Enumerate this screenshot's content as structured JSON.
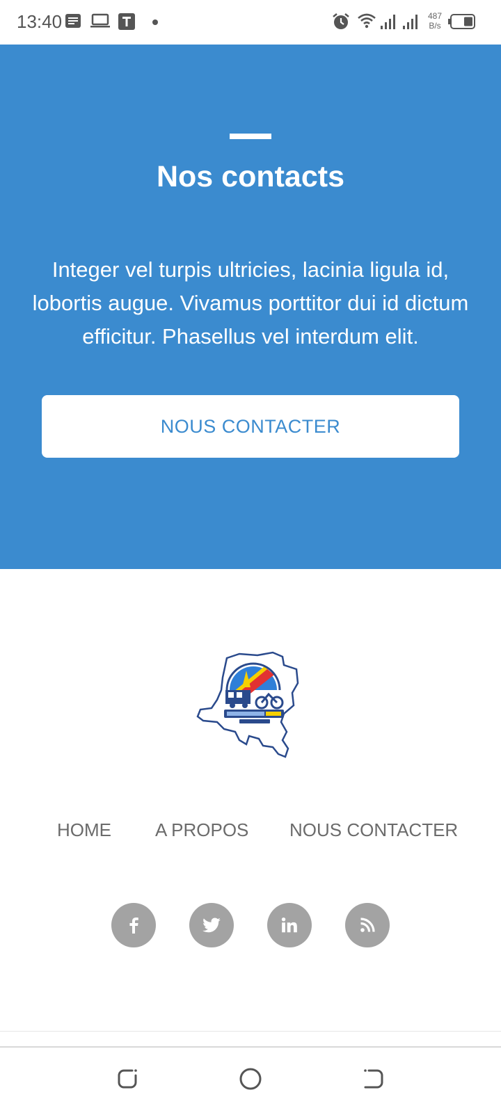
{
  "status_bar": {
    "time": "13:40",
    "net_speed_value": "487",
    "net_speed_unit": "B/s",
    "icons": [
      "notes-icon",
      "laptop-icon",
      "t-app-icon",
      "dot-icon",
      "alarm-icon",
      "wifi-icon",
      "signal-icon",
      "signal-icon",
      "battery-icon"
    ]
  },
  "hero": {
    "title": "Nos contacts",
    "body": "Integer vel turpis ultricies, lacinia ligula id, lobortis augue. Vivamus porttitor dui id dictum efficitur. Phasellus vel interdum elit.",
    "button_label": "NOUS CONTACTER",
    "background": "#3b8bcf",
    "accent": "#ffffff"
  },
  "footer": {
    "links": [
      "HOME",
      "A PROPOS",
      "NOUS CONTACTER"
    ],
    "social": [
      "facebook-icon",
      "twitter-icon",
      "linkedin-icon",
      "rss-icon"
    ],
    "social_color": "#a3a3a3",
    "link_color": "#6b6b6b"
  },
  "nav_bar": {
    "buttons": [
      "recent-apps-icon",
      "home-icon",
      "back-icon"
    ]
  }
}
